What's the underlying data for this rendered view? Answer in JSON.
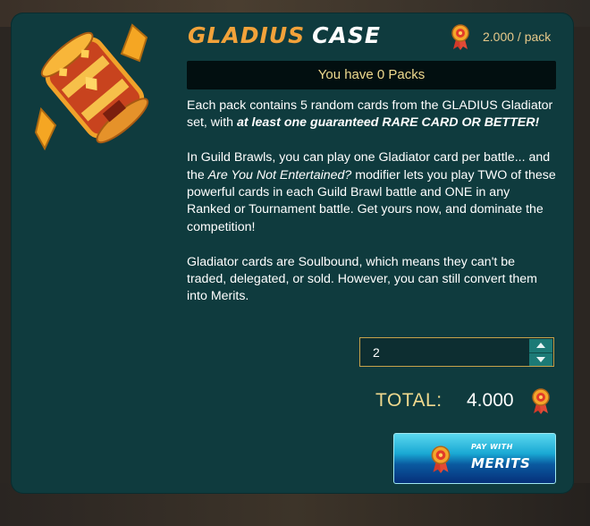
{
  "title": {
    "part1": "GLADIUS",
    "part2": "CASE"
  },
  "price": {
    "text": "2.000 / pack",
    "icon": "merit-medal-icon"
  },
  "packs_banner": "You have 0 Packs",
  "description": {
    "p1_text": "Each pack contains 5 random cards from the GLADIUS Gladiator set, with ",
    "p1_emphasis": "at least one guaranteed RARE CARD OR BETTER!",
    "p2_a": "In Guild Brawls, you can play one Gladiator card per battle... and the ",
    "p2_italic": "Are You Not Entertained?",
    "p2_b": " modifier lets you play TWO of these powerful cards in each Guild Brawl battle and ONE in any Ranked or Tournament battle. Get yours now, and dominate the competition!",
    "p3": "Gladiator cards are Soulbound, which means they can't be traded, delegated, or sold. However, you can still convert them into Merits."
  },
  "quantity": {
    "value": "2"
  },
  "total": {
    "label": "TOTAL:",
    "value": "4.000"
  },
  "pay_button": {
    "line1": "PAY WITH",
    "line2": "MERITS"
  },
  "colors": {
    "panel": "#0f3b3e",
    "accent_gold": "#f2a23a",
    "text_gold": "#f0d98e",
    "button_blue": "#1aa9d4"
  }
}
